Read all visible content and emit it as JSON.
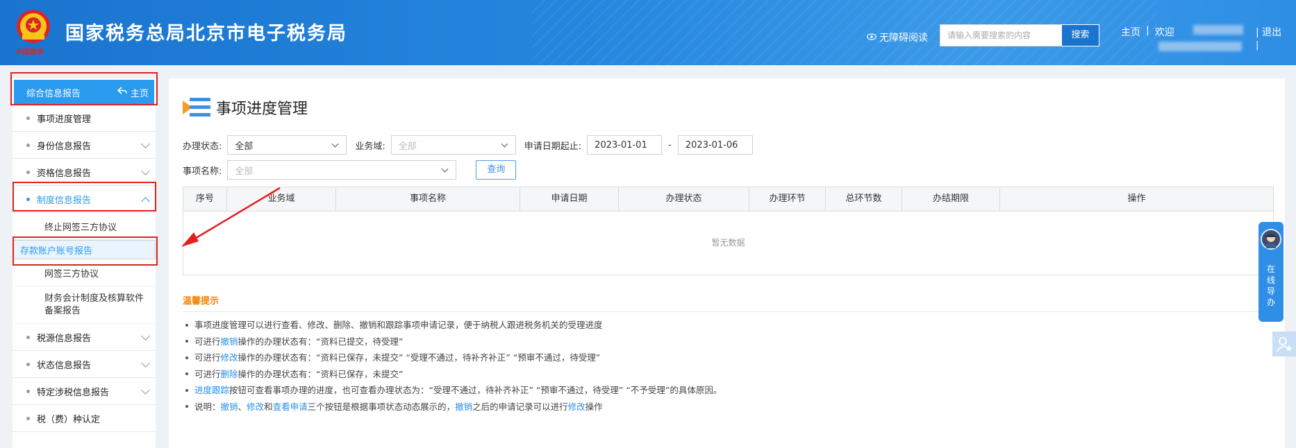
{
  "header": {
    "emblem_caption": "中国税务",
    "site_title": "国家税务总局北京市电子税务局",
    "accessibility_label": "无障碍阅读",
    "search_placeholder": "请输入需要搜索的内容",
    "search_button": "搜索",
    "home_link": "主页",
    "divider": "|",
    "welcome": "欢迎",
    "logout": "退出"
  },
  "sidebar": {
    "header_label": "综合信息报告",
    "home_label": "主页",
    "items": [
      {
        "label": "事项进度管理",
        "expandable": false
      },
      {
        "label": "身份信息报告",
        "expandable": true
      },
      {
        "label": "资格信息报告",
        "expandable": true
      },
      {
        "label": "制度信息报告",
        "expandable": true,
        "expanded": true,
        "children": [
          "终止网签三方协议",
          "存款账户账号报告",
          "网签三方协议",
          "财务会计制度及核算软件备案报告"
        ]
      },
      {
        "label": "税源信息报告",
        "expandable": true
      },
      {
        "label": "状态信息报告",
        "expandable": true
      },
      {
        "label": "特定涉税信息报告",
        "expandable": true
      },
      {
        "label": "税（费）种认定",
        "expandable": false
      }
    ]
  },
  "main": {
    "page_title": "事项进度管理",
    "filters": {
      "status_label": "办理状态:",
      "status_value": "全部",
      "domain_label": "业务域:",
      "domain_placeholder": "全部",
      "date_label": "申请日期起止:",
      "date_start": "2023-01-01",
      "date_sep": "-",
      "date_end": "2023-01-06",
      "item_name_label": "事项名称:",
      "item_name_placeholder": "全部",
      "query_button": "查询"
    },
    "table": {
      "columns": [
        "序号",
        "业务域",
        "事项名称",
        "申请日期",
        "办理状态",
        "办理环节",
        "总环节数",
        "办结期限",
        "操作"
      ],
      "empty_text": "暂无数据"
    },
    "tips": {
      "title": "温馨提示",
      "lines": [
        [
          {
            "t": "事项进度管理可以进行查看、修改、删除、撤销和跟踪事项申请记录，便于纳税人跟进税务机关的受理进度"
          }
        ],
        [
          {
            "t": "可进行"
          },
          {
            "t": "撤销",
            "hl": true
          },
          {
            "t": "操作的办理状态有：“资料已提交，待受理”"
          }
        ],
        [
          {
            "t": "可进行"
          },
          {
            "t": "修改",
            "hl": true
          },
          {
            "t": "操作的办理状态有：“资料已保存，未提交” “受理不通过，待补齐补正” “预审不通过，待受理”"
          }
        ],
        [
          {
            "t": "可进行"
          },
          {
            "t": "删除",
            "hl": true
          },
          {
            "t": "操作的办理状态有：“资料已保存，未提交”"
          }
        ],
        [
          {
            "t": "进度跟踪",
            "hl": true
          },
          {
            "t": "按钮可查看事项办理的进度，也可查看办理状态为：“受理不通过，待补齐补正” “预审不通过，待受理” “不予受理”的具体原因。"
          }
        ],
        [
          {
            "t": "说明："
          },
          {
            "t": "撤销",
            "hl": true
          },
          {
            "t": "、"
          },
          {
            "t": "修改",
            "hl": true
          },
          {
            "t": "和"
          },
          {
            "t": "查看申请",
            "hl": true
          },
          {
            "t": "三个按钮是根据事项状态动态展示的，"
          },
          {
            "t": "撤销",
            "hl": true
          },
          {
            "t": "之后的申请记录可以进行"
          },
          {
            "t": "修改",
            "hl": true
          },
          {
            "t": "操作"
          }
        ]
      ]
    }
  },
  "float_guide": {
    "label": [
      "在",
      "线",
      "导",
      "办"
    ]
  },
  "colors": {
    "header_blue": "#1a74cf",
    "accent_blue": "#2b9bf0",
    "tip_orange": "#f08300",
    "annotation_red": "#e51e1e"
  }
}
